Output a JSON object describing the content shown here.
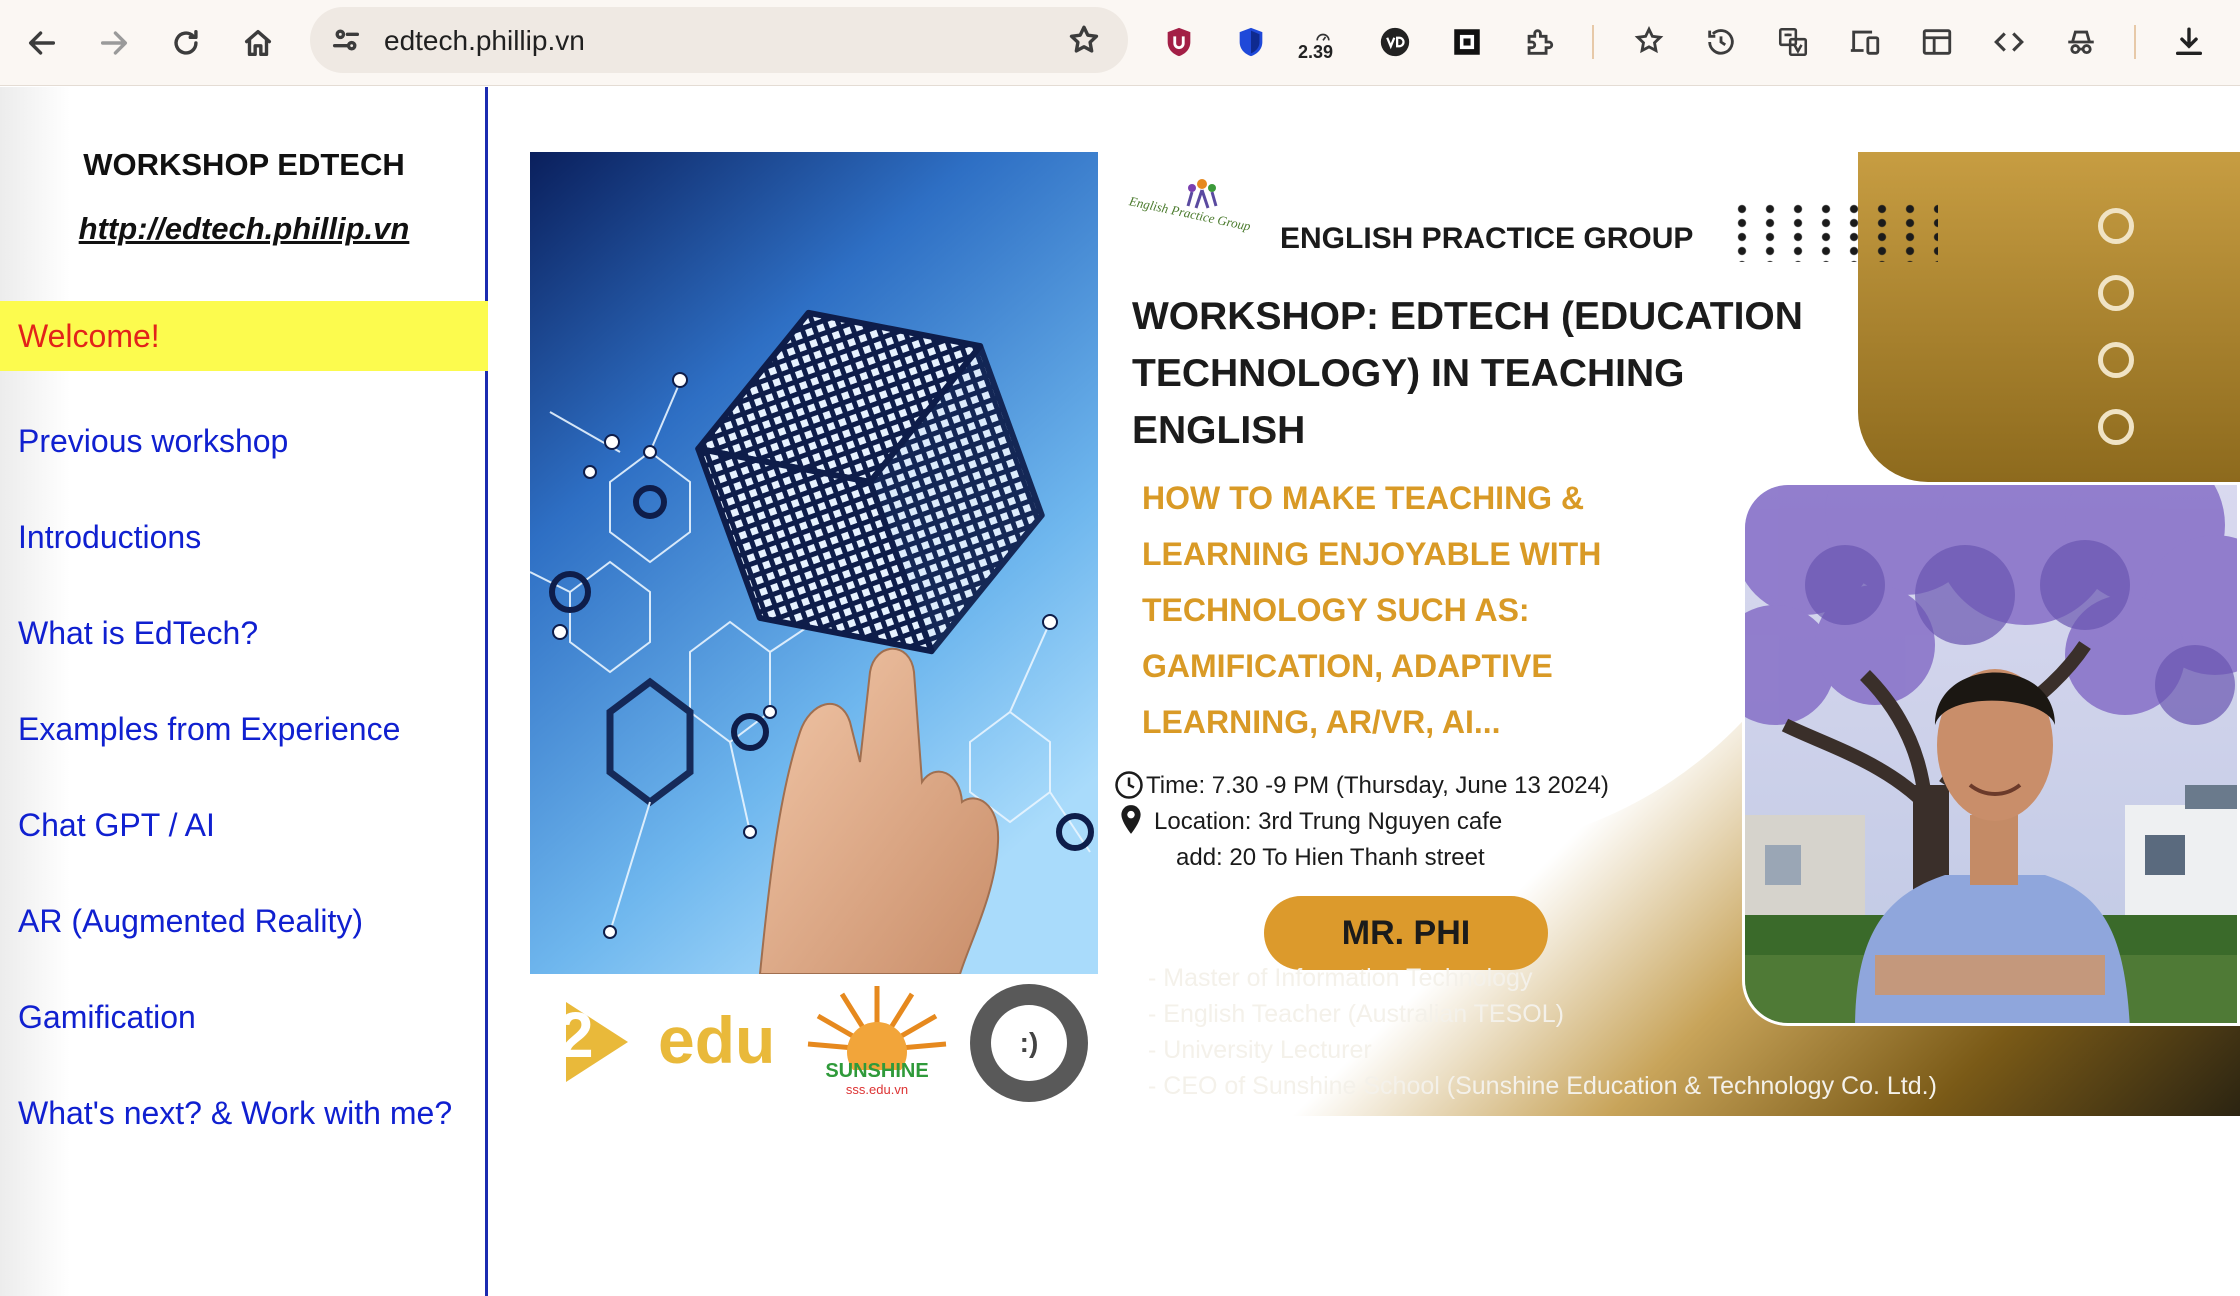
{
  "browser": {
    "url": "edtech.phillip.vn",
    "counter": "2.39"
  },
  "sidebar": {
    "title": "WORKSHOP EDTECH",
    "url_link": "http://edtech.phillip.vn",
    "items": [
      {
        "label": "Welcome!",
        "active": true
      },
      {
        "label": "Previous workshop"
      },
      {
        "label": "Introductions"
      },
      {
        "label": "What is EdTech?"
      },
      {
        "label": "Examples from Experience"
      },
      {
        "label": "Chat GPT / AI"
      },
      {
        "label": "AR (Augmented Reality)"
      },
      {
        "label": "Gamification"
      },
      {
        "label": "What's next? & Work with me?"
      }
    ]
  },
  "banner": {
    "group_logo_text": "English Practice Group",
    "group_name": "ENGLISH PRACTICE GROUP",
    "title": "WORKSHOP: EDTECH (EDUCATION TECHNOLOGY) IN TEACHING ENGLISH",
    "subtitle": "HOW TO MAKE TEACHING & LEARNING ENJOYABLE WITH TECHNOLOGY SUCH AS: GAMIFICATION, ADAPTIVE LEARNING, AR/VR, AI...",
    "time": "Time: 7.30 -9 PM (Thursday, June 13 2024)",
    "location": "Location: 3rd Trung Nguyen cafe",
    "address": "add: 20 To Hien Thanh street",
    "speaker": "MR. PHI",
    "credentials": [
      "- Master of Information Technology",
      "- English Teacher (Australian TESOL)",
      "- University Lecturer",
      "- CEO of Sunshine School (Sunshine Education & Technology Co. Ltd.)"
    ],
    "logos": {
      "edu": "edu",
      "edu_number": "2",
      "sunshine": "SUNSHINE",
      "sunshine_url": "sss.edu.vn",
      "p_logo_glyph": ":)"
    }
  }
}
